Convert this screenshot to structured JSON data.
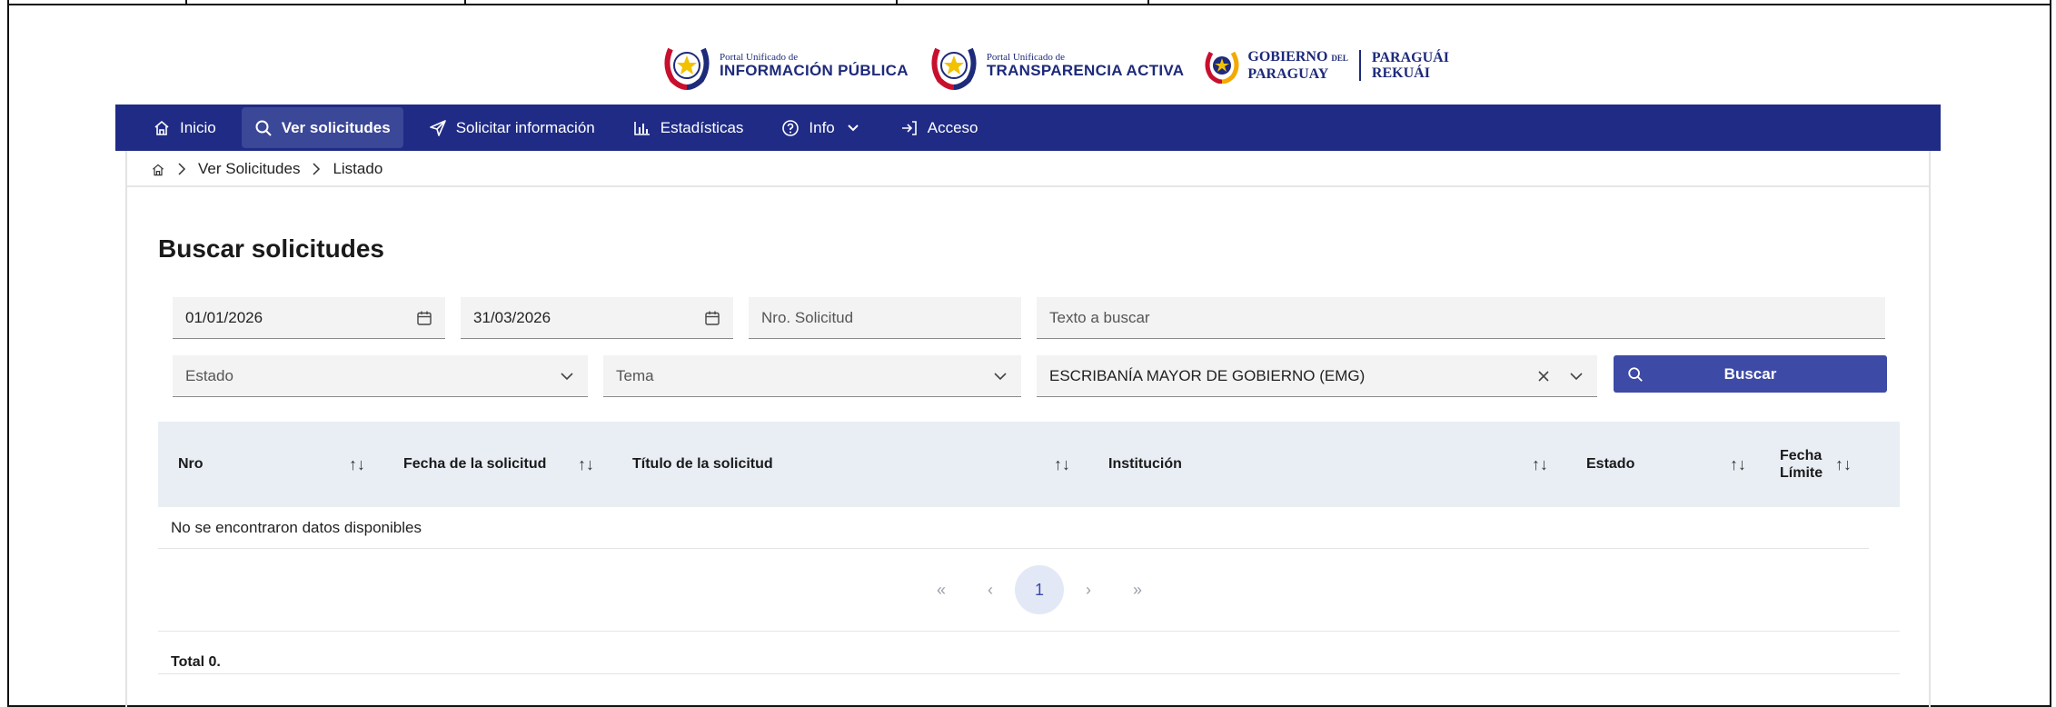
{
  "logos": {
    "pui": {
      "small": "Portal Unificado de",
      "big": "INFORMACIÓN PÚBLICA"
    },
    "pta": {
      "small": "Portal Unificado de",
      "big": "TRANSPARENCIA ACTIVA"
    },
    "gob": {
      "line1": "GOBIERNO",
      "del": "DEL",
      "line2": "PARAGUAY",
      "line3": "PARAGUÁI",
      "line4": "REKUÁI"
    }
  },
  "nav": {
    "inicio": "Inicio",
    "ver_solicitudes": "Ver solicitudes",
    "solicitar": "Solicitar información",
    "estadisticas": "Estadísticas",
    "info": "Info",
    "acceso": "Acceso"
  },
  "breadcrumb": {
    "item1": "Ver Solicitudes",
    "item2": "Listado"
  },
  "page_title": "Buscar solicitudes",
  "filters": {
    "fecha_desde": "01/01/2026",
    "fecha_hasta": "31/03/2026",
    "nro_placeholder": "Nro. Solicitud",
    "texto_placeholder": "Texto a buscar",
    "estado_placeholder": "Estado",
    "tema_placeholder": "Tema",
    "institucion_value": "ESCRIBANÍA MAYOR DE GOBIERNO (EMG)",
    "buscar_label": "Buscar"
  },
  "table": {
    "columns": {
      "nro": "Nro",
      "fecha": "Fecha de la solicitud",
      "titulo": "Título de la solicitud",
      "institucion": "Institución",
      "estado": "Estado",
      "fecha_limite_1": "Fecha",
      "fecha_limite_2": "Límite"
    },
    "empty_message": "No se encontraron datos disponibles"
  },
  "pagination": {
    "first": "«",
    "prev": "‹",
    "current": "1",
    "next": "›",
    "last": "»"
  },
  "total": "Total 0.",
  "colors": {
    "navbar": "#1f2b85",
    "active_nav": "#3b4797",
    "button": "#3d4aa6",
    "table_header": "#e9eef5"
  }
}
